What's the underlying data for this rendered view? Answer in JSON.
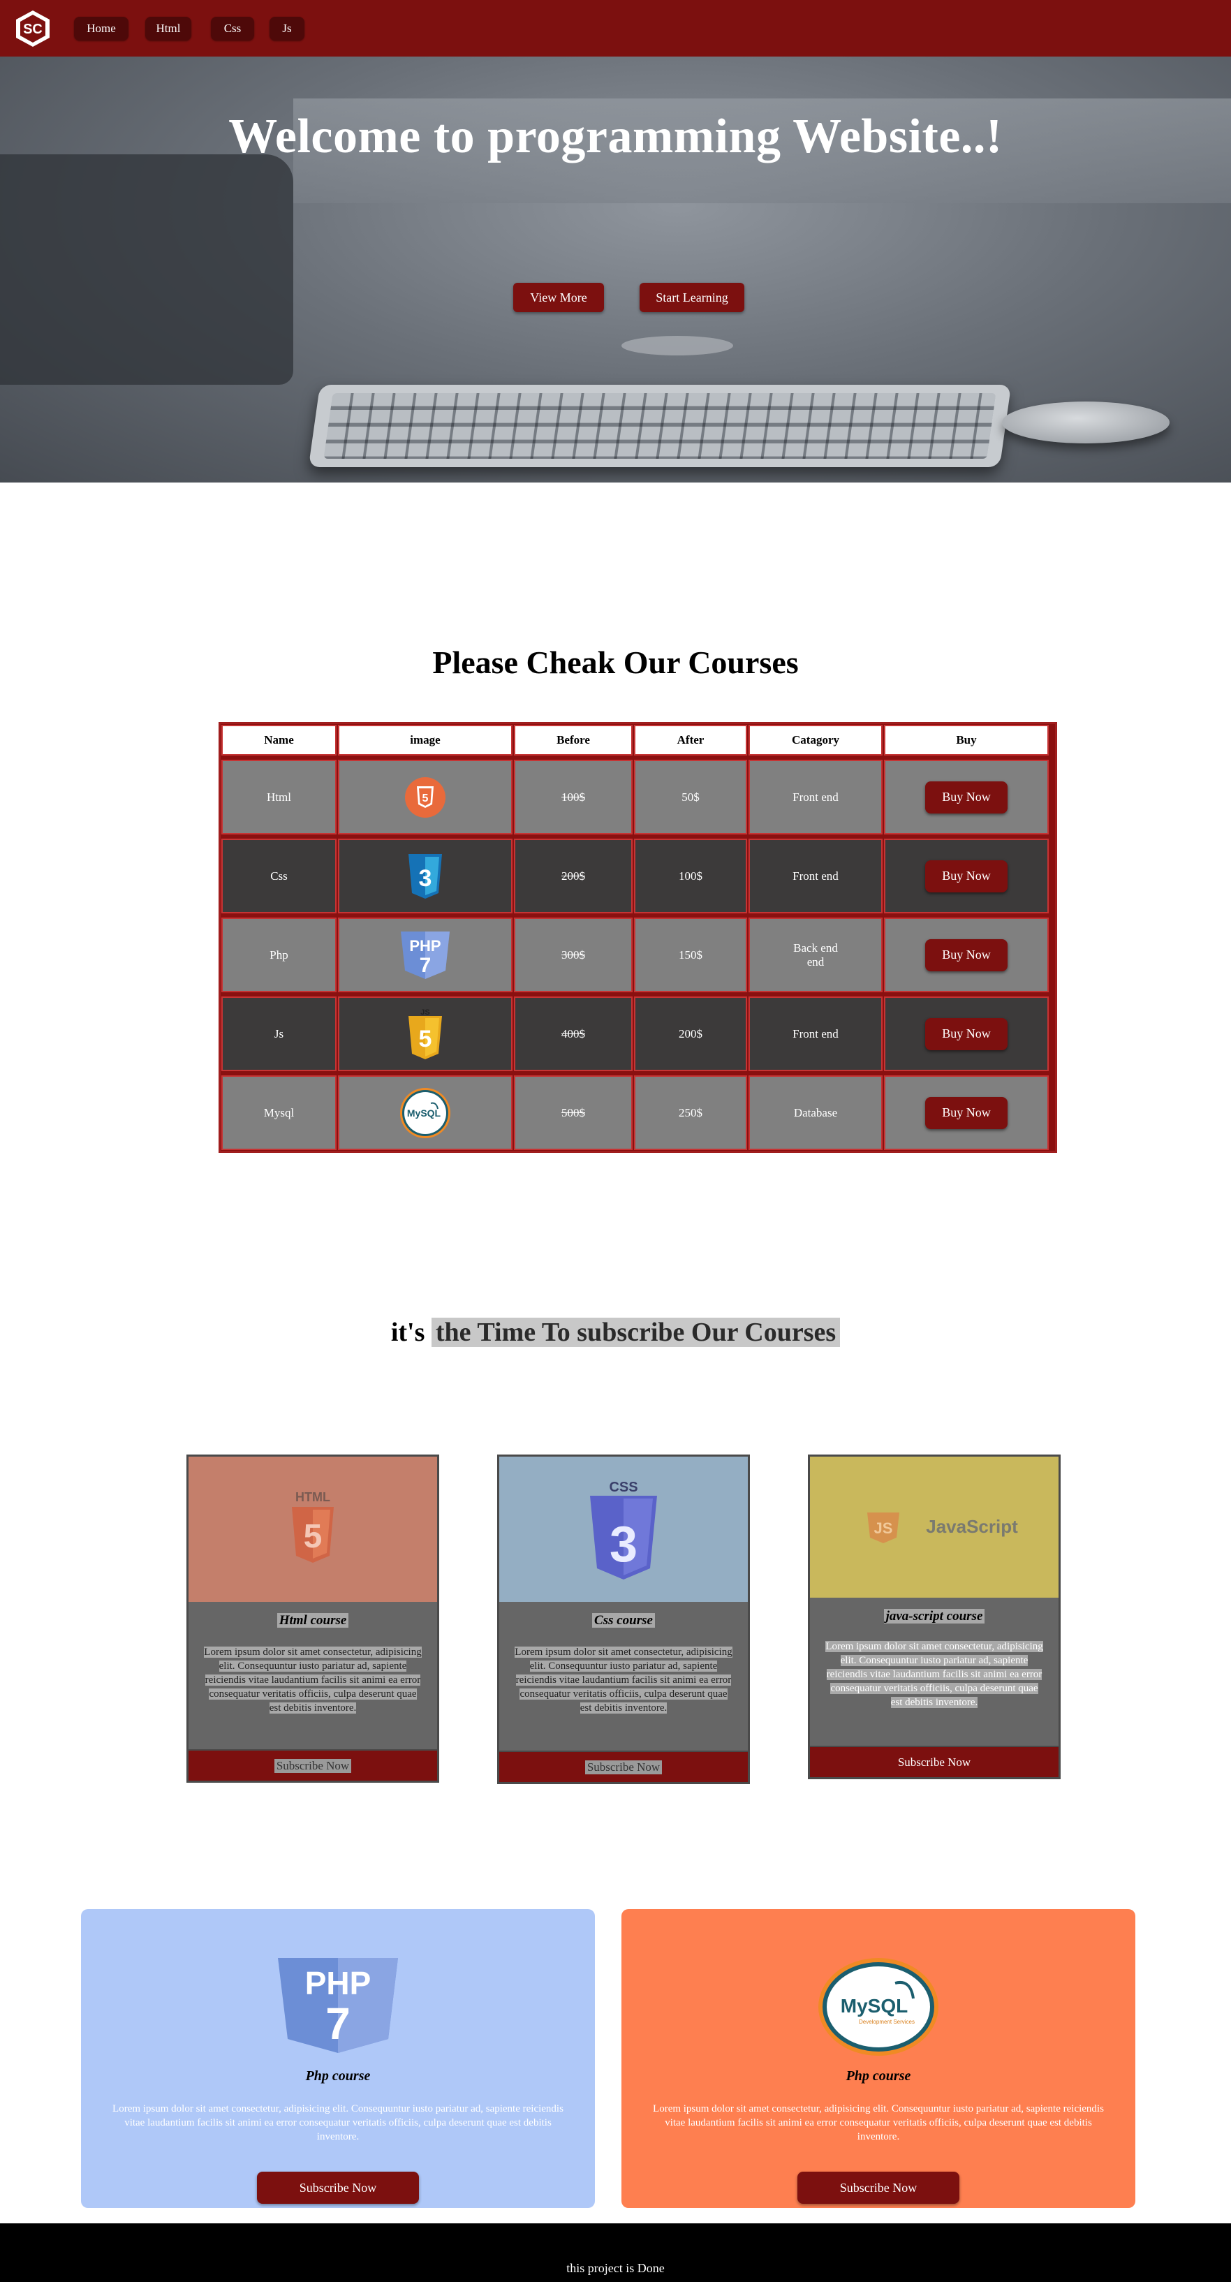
{
  "nav": {
    "logo_text": "SC",
    "items": [
      {
        "label": "Home"
      },
      {
        "label": "Html"
      },
      {
        "label": "Css"
      },
      {
        "label": "Js"
      }
    ]
  },
  "hero": {
    "title": "Welcome to programming Website..!",
    "buttons": [
      {
        "label": "View More"
      },
      {
        "label": "Start Learning"
      }
    ]
  },
  "courses": {
    "title": "Please Cheak Our Courses",
    "headers": [
      "Name",
      "image",
      "Before",
      "After",
      "Catagory",
      "Buy"
    ],
    "rows": [
      {
        "name": "Html",
        "icon": "html5-icon",
        "before": "100$",
        "after": "50$",
        "category": "Front end",
        "buy": "Buy Now"
      },
      {
        "name": "Css",
        "icon": "css3-icon",
        "before": "200$",
        "after": "100$",
        "category": "Front end",
        "buy": "Buy Now"
      },
      {
        "name": "Php",
        "icon": "php7-icon",
        "before": "300$",
        "after": "150$",
        "category": "Back end end",
        "buy": "Buy Now"
      },
      {
        "name": "Js",
        "icon": "js-icon",
        "before": "400$",
        "after": "200$",
        "category": "Front end",
        "buy": "Buy Now"
      },
      {
        "name": "Mysql",
        "icon": "mysql-icon",
        "before": "500$",
        "after": "250$",
        "category": "Database",
        "buy": "Buy Now"
      }
    ]
  },
  "subscribe": {
    "title_prefix": "it's",
    "title_highlight": "the Time To subscribe Our Courses",
    "cards": [
      {
        "name": "Html course",
        "logo_label": "HTML",
        "logo_digit": "5",
        "text": "Lorem ipsum dolor sit amet consectetur, adipisicing elit. Consequuntur iusto pariatur ad, sapiente reiciendis vitae laudantium facilis sit animi ea error consequatur veritatis officiis, culpa deserunt quae est debitis inventore.",
        "button": "Subscribe Now",
        "bg": "#c47f6b"
      },
      {
        "name": "Css course",
        "logo_label": "CSS",
        "logo_digit": "3",
        "text": "Lorem ipsum dolor sit amet consectetur, adipisicing elit. Consequuntur iusto pariatur ad, sapiente reiciendis vitae laudantium facilis sit animi ea error consequatur veritatis officiis, culpa deserunt quae est debitis inventore.",
        "button": "Subscribe Now",
        "bg": "#94aec3"
      },
      {
        "name": "java-script course",
        "logo_label": "JavaScript",
        "logo_digit": "JS",
        "text": "Lorem ipsum dolor sit amet consectetur, adipisicing elit. Consequuntur iusto pariatur ad, sapiente reiciendis vitae laudantium facilis sit animi ea error consequatur veritatis officiis, culpa deserunt quae est debitis inventore.",
        "button": "Subscribe Now",
        "bg": "#c9b85c"
      }
    ]
  },
  "big_cards": [
    {
      "name": "Php course",
      "logo_label": "PHP",
      "logo_digit": "7",
      "text": "Lorem ipsum dolor sit amet consectetur, adipisicing elit. Consequuntur iusto pariatur ad, sapiente reiciendis vitae laudantium facilis sit animi ea error consequatur veritatis officiis, culpa deserunt quae est debitis inventore.",
      "button": "Subscribe Now",
      "bg": "#afc8f8"
    },
    {
      "name": "Php course",
      "logo_label": "MySQL",
      "logo_sub": "Development Services",
      "text": "Lorem ipsum dolor sit amet consectetur, adipisicing elit. Consequuntur iusto pariatur ad, sapiente reiciendis vitae laudantium facilis sit animi ea error consequatur veritatis officiis, culpa deserunt quae est debitis inventore.",
      "button": "Subscribe Now",
      "bg": "#fe7f50"
    }
  ],
  "footer": {
    "text": "this project is Done"
  },
  "colors": {
    "brand": "#7c100f",
    "nav_button": "#4e0909"
  }
}
